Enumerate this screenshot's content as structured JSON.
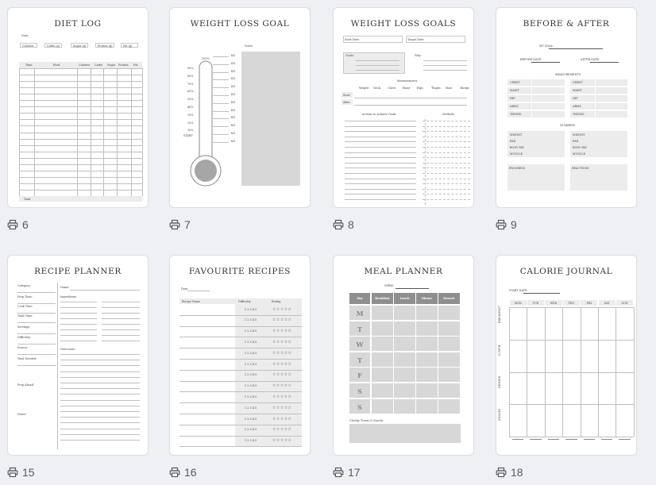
{
  "pages": [
    {
      "number": "6",
      "title": "DIET LOG",
      "date_label": "Date:",
      "summary": [
        "Calories",
        "Carbs (g)",
        "Sugar (g)",
        "Protein (g)",
        "Fat (g)"
      ],
      "columns": [
        "Time",
        "Food",
        "Calories",
        "Carbs",
        "Sugar",
        "Protein",
        "Fat"
      ],
      "total_label": "Total"
    },
    {
      "number": "7",
      "title": "WEIGHT LOSS GOAL",
      "percent_top": "100%",
      "percents": [
        "90%",
        "80%",
        "70%",
        "60%",
        "50%",
        "40%",
        "30%",
        "20%",
        "10%"
      ],
      "start_label": "START",
      "kg": [
        "KG",
        "KG",
        "KG",
        "KG",
        "KG",
        "KG",
        "KG",
        "KG",
        "KG",
        "KG",
        "KG",
        "KG"
      ],
      "notes_label": "Notes"
    },
    {
      "number": "8",
      "title": "WEIGHT LOSS GOALS",
      "start_date": "Start Date:",
      "target_date": "Target Date:",
      "goals_label": "Goals:",
      "why_label": "Why:",
      "measurements_title": "Measurements",
      "measure_cols": [
        "Weight",
        "Neck",
        "Chest",
        "Waist",
        "Hips",
        "Thighs",
        "Bust",
        "Biceps"
      ],
      "rows": [
        "Start",
        "After"
      ],
      "actions_label": "Actions to Achieve Goals",
      "methods_label": "Methods"
    },
    {
      "number": "9",
      "title": "BEFORE & AFTER",
      "my_goal": "MY GOAL:",
      "before_date": "BEFORE DATE:",
      "after_date": "AFTER DATE:",
      "measurements": "MEASUREMENTS",
      "measure_items": [
        "CHEST",
        "WAIST",
        "HIP",
        "ARMS",
        "THIGHS"
      ],
      "numbers": "NUMBERS",
      "number_items": [
        "WEIGHT",
        "BMI",
        "BODY FAT",
        "MUSCLE"
      ],
      "progress": "PROGRESS",
      "reactions": "REACTIONS"
    },
    {
      "number": "15",
      "title": "RECIPE PLANNER",
      "fields": [
        "Category:",
        "Prep Time:",
        "Cook Time:",
        "Total Time:",
        "Servings:",
        "Difficulty:",
        "Source:",
        "Total Needed:",
        "Prep Ahead:",
        "Notes:"
      ],
      "name_label": "Name:",
      "ingredients_label": "Ingredients:",
      "directions_label": "Directions:"
    },
    {
      "number": "16",
      "title": "FAVOURITE RECIPES",
      "date_label": "Date:",
      "columns": [
        "Recipe Name",
        "Difficulty",
        "Rating"
      ],
      "scale": "1 2 3 4 5",
      "stars": "☆☆☆☆☆"
    },
    {
      "number": "17",
      "title": "MEAL PLANNER",
      "week_label": "WEEK:",
      "columns": [
        "Day",
        "Breakfast",
        "Lunch",
        "Dinner",
        "Dessert"
      ],
      "days": [
        "M",
        "T",
        "W",
        "T",
        "F",
        "S",
        "S"
      ],
      "snacks_label": "Cheeky Treats & Snacks:"
    },
    {
      "number": "18",
      "title": "CALORIE JOURNAL",
      "start_date": "START DATE:",
      "days": [
        "MON",
        "TUE",
        "WED",
        "THU",
        "FRI",
        "SAT",
        "SUN"
      ],
      "meals": [
        "BREAKFAST",
        "LUNCH",
        "DINNER",
        "SNACKS"
      ]
    }
  ]
}
